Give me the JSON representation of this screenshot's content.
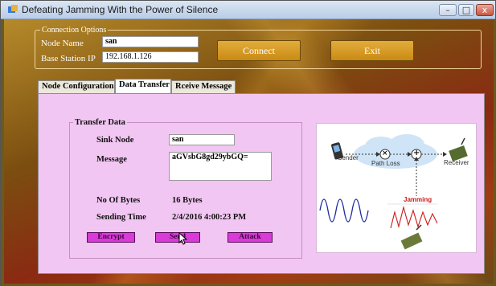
{
  "window": {
    "title": "Defeating Jamming With the Power of Silence",
    "controls": {
      "minimize": "–",
      "maximize": "□",
      "close": "x"
    }
  },
  "connection": {
    "legend": "Connection Options",
    "node_name_label": "Node Name",
    "node_name_value": "san",
    "base_station_label": "Base Station IP",
    "base_station_value": "192.168.1.126",
    "connect_label": "Connect",
    "exit_label": "Exit"
  },
  "tabs": [
    {
      "label": "Node Configuration",
      "active": false
    },
    {
      "label": "Data Transfer",
      "active": true
    },
    {
      "label": "Rceive Message",
      "active": false
    }
  ],
  "transfer": {
    "legend": "Transfer Data",
    "sink_node_label": "Sink Node",
    "sink_node_value": "san",
    "message_label": "Message",
    "message_value": "aGVsbG8gd29ybGQ=",
    "bytes_label": "No Of Bytes",
    "bytes_value": "16 Bytes",
    "time_label": "Sending Time",
    "time_value": "2/4/2016 4:00:23 PM",
    "encrypt_label": "Encrypt",
    "send_label": "Send",
    "attack_label": "Attack"
  },
  "diagram": {
    "sender_label": "Sender",
    "path_loss_label": "Path Loss",
    "receiver_label": "Receiver",
    "jamming_label": "Jamming",
    "multiply_symbol": "×",
    "plus_symbol": "+"
  },
  "colors": {
    "accent_gold": "#d69e26",
    "panel_pink": "#f2c6f2",
    "button_magenta": "#d83bd8",
    "jamming_red": "#cc1a1a",
    "cloud_blue": "#cfe4f7"
  }
}
